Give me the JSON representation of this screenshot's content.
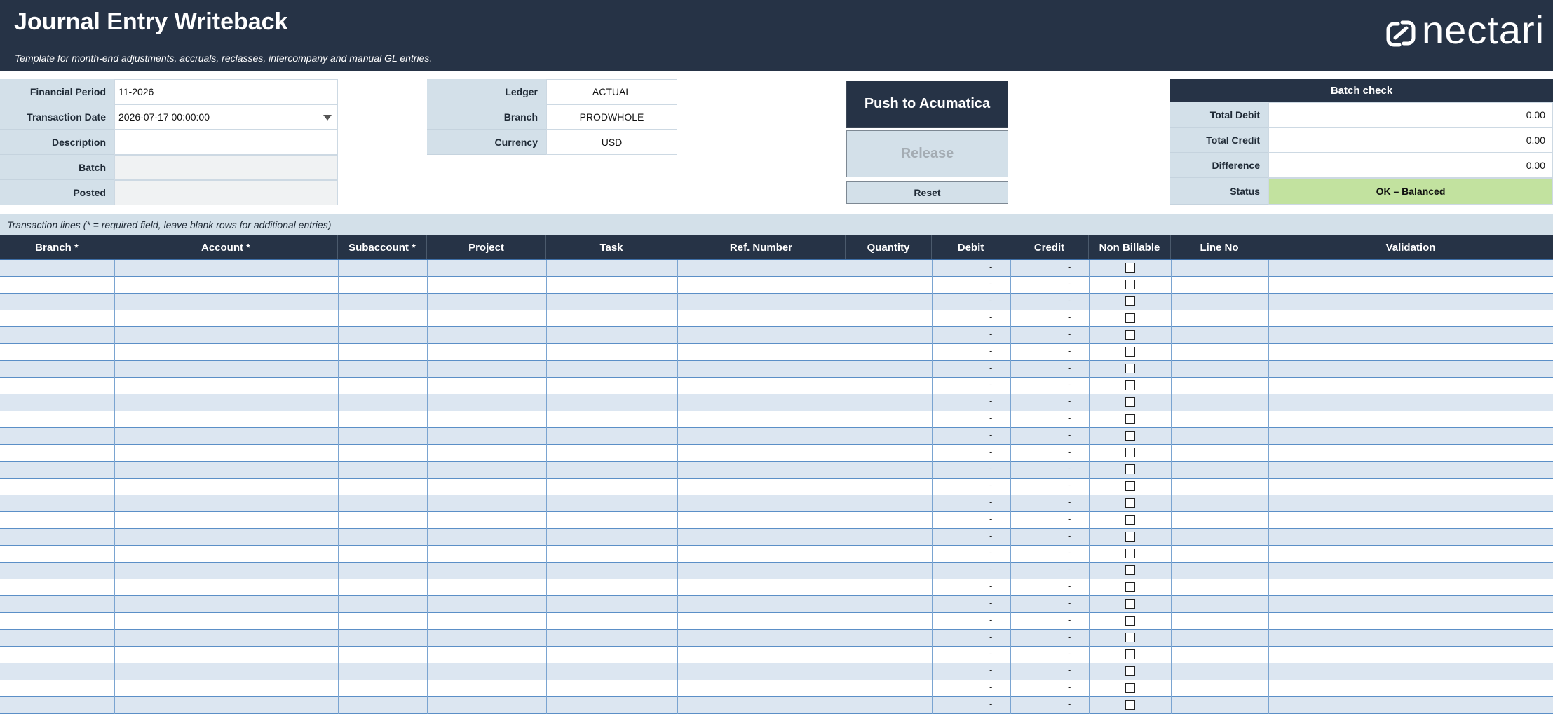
{
  "header": {
    "title": "Journal Entry Writeback",
    "subtitle": "Template for month-end adjustments, accruals, reclasses, intercompany and manual GL entries.",
    "logo_text": "nectari"
  },
  "form_left": {
    "financial_period": {
      "label": "Financial Period",
      "value": "11-2026"
    },
    "transaction_date": {
      "label": "Transaction Date",
      "value": "2026-07-17 00:00:00"
    },
    "description": {
      "label": "Description",
      "value": ""
    },
    "batch": {
      "label": "Batch",
      "value": ""
    },
    "posted": {
      "label": "Posted",
      "value": ""
    }
  },
  "form_mid": {
    "ledger": {
      "label": "Ledger",
      "value": "ACTUAL"
    },
    "branch": {
      "label": "Branch",
      "value": "PRODWHOLE"
    },
    "currency": {
      "label": "Currency",
      "value": "USD"
    }
  },
  "actions": {
    "push_label": "Push to Acumatica",
    "release_label": "Release",
    "reset_label": "Reset"
  },
  "batch_check": {
    "title": "Batch check",
    "total_debit": {
      "label": "Total Debit",
      "value": "0.00"
    },
    "total_credit": {
      "label": "Total Credit",
      "value": "0.00"
    },
    "difference": {
      "label": "Difference",
      "value": "0.00"
    },
    "status": {
      "label": "Status",
      "value": "OK – Balanced"
    }
  },
  "transaction_lines": {
    "label": "Transaction lines   (* = required field, leave blank rows for additional entries)",
    "columns": [
      "Branch *",
      "Account *",
      "Subaccount *",
      "Project",
      "Task",
      "Ref. Number",
      "Quantity",
      "Debit",
      "Credit",
      "Non Billable",
      "Line No",
      "Validation"
    ],
    "empty_amount": "-",
    "row_count": 27
  },
  "colors": {
    "banner": "#263346",
    "label_bg": "#d3e0e9",
    "row_alt": "#dce6f1",
    "status_ok": "#c2e29f"
  }
}
